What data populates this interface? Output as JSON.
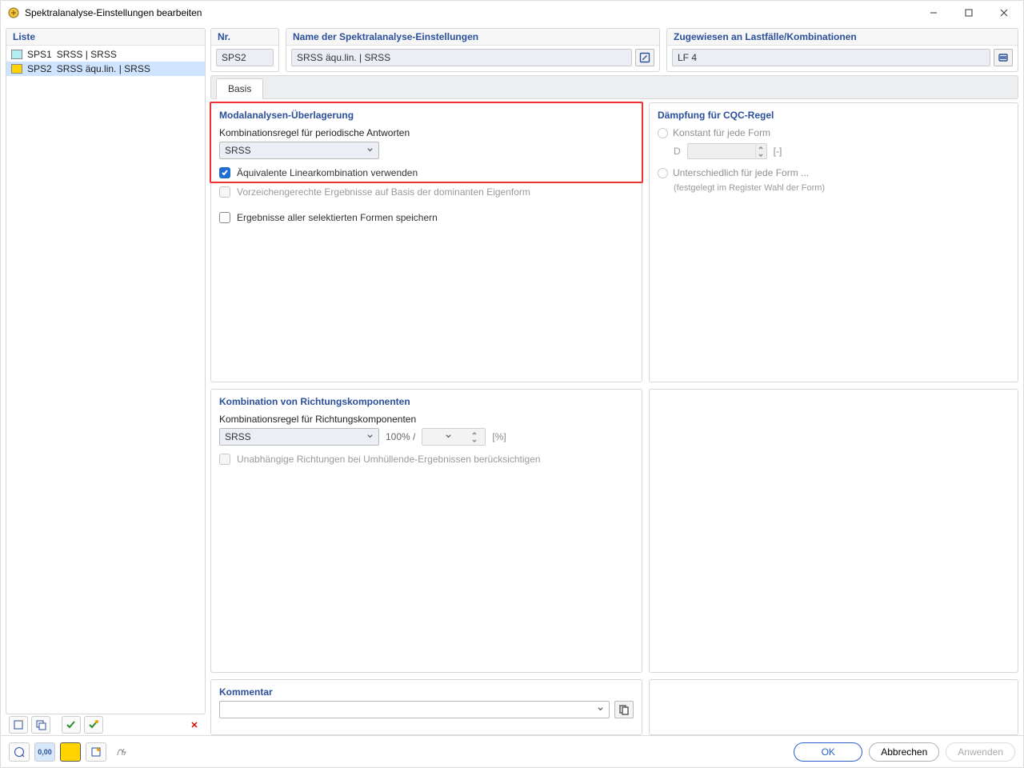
{
  "window": {
    "title": "Spektralanalyse-Einstellungen bearbeiten"
  },
  "left": {
    "header": "Liste",
    "items": [
      {
        "id": "SPS1",
        "label": "SRSS | SRSS",
        "color": "#b3eef2",
        "selected": false
      },
      {
        "id": "SPS2",
        "label": "SRSS äqu.lin. | SRSS",
        "color": "#ffd400",
        "selected": true
      }
    ]
  },
  "top": {
    "nr": {
      "header": "Nr.",
      "value": "SPS2"
    },
    "name": {
      "header": "Name der Spektralanalyse-Einstellungen",
      "value": "SRSS äqu.lin. | SRSS"
    },
    "assigned": {
      "header": "Zugewiesen an Lastfälle/Kombinationen",
      "value": "LF 4"
    }
  },
  "tabs": {
    "basis": "Basis"
  },
  "modal": {
    "title": "Modalanalysen-Überlagerung",
    "rule_label": "Kombinationsregel für periodische Antworten",
    "rule_value": "SRSS",
    "chk_equiv": "Äquivalente Linearkombination verwenden",
    "chk_signed": "Vorzeichengerechte Ergebnisse auf Basis der dominanten Eigenform",
    "chk_save": "Ergebnisse aller selektierten Formen speichern"
  },
  "damping": {
    "title": "Dämpfung für CQC-Regel",
    "opt_const": "Konstant für jede Form",
    "d_label": "D",
    "d_unit": "[-]",
    "opt_diff": "Unterschiedlich für jede Form ...",
    "opt_diff_note": "(festgelegt im Register Wahl der Form)"
  },
  "direction": {
    "title": "Kombination von Richtungskomponenten",
    "rule_label": "Kombinationsregel für Richtungskomponenten",
    "rule_value": "SRSS",
    "pct_prefix": "100% /",
    "pct_unit": "[%]",
    "chk_independent": "Unabhängige Richtungen bei Umhüllende-Ergebnissen berücksichtigen"
  },
  "comment": {
    "title": "Kommentar"
  },
  "buttons": {
    "ok": "OK",
    "cancel": "Abbrechen",
    "apply": "Anwenden"
  }
}
